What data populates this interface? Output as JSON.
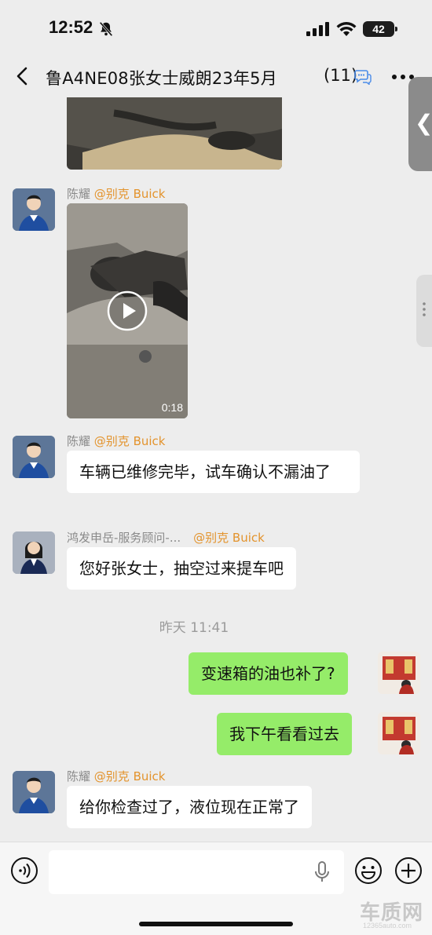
{
  "status_bar": {
    "time": "12:52",
    "battery": "42",
    "icons": [
      "bell-off-icon",
      "signal-icon",
      "wifi-icon",
      "battery-icon"
    ]
  },
  "nav": {
    "title": "鲁A4NE08张女士威朗23年5月",
    "title_tail": "←",
    "count": "(11)",
    "icons": [
      "back-icon",
      "chat-bubbles-icon",
      "more-icon"
    ]
  },
  "messages": {
    "m1": {
      "sender": "陈耀",
      "tag": "@别克 Buick",
      "video_duration": "0:18"
    },
    "m2": {
      "sender": "陈耀",
      "tag": "@别克 Buick",
      "text": "车辆已维修完毕，试车确认不漏油了"
    },
    "m3": {
      "sender": "鸿发申岳-服务顾问-...",
      "tag": "@别克 Buick",
      "text": "您好张女士，抽空过来提车吧"
    },
    "time_separator": "昨天 11:41",
    "m4": {
      "text": "变速箱的油也补了?"
    },
    "m5": {
      "text": "我下午看看过去"
    },
    "m6": {
      "sender": "陈耀",
      "tag": "@别克 Buick",
      "text": "给你检查过了，液位现在正常了"
    }
  },
  "input_bar": {
    "placeholder": "",
    "icons": [
      "voice-icon",
      "mic-icon",
      "emoji-icon",
      "plus-icon"
    ]
  },
  "watermark": {
    "main": "车质网",
    "sub": "12365auto.com"
  },
  "colors": {
    "background": "#ededed",
    "my_bubble": "#95ec69",
    "tag": "#e3932c",
    "input_bar": "#f6f6f6"
  }
}
